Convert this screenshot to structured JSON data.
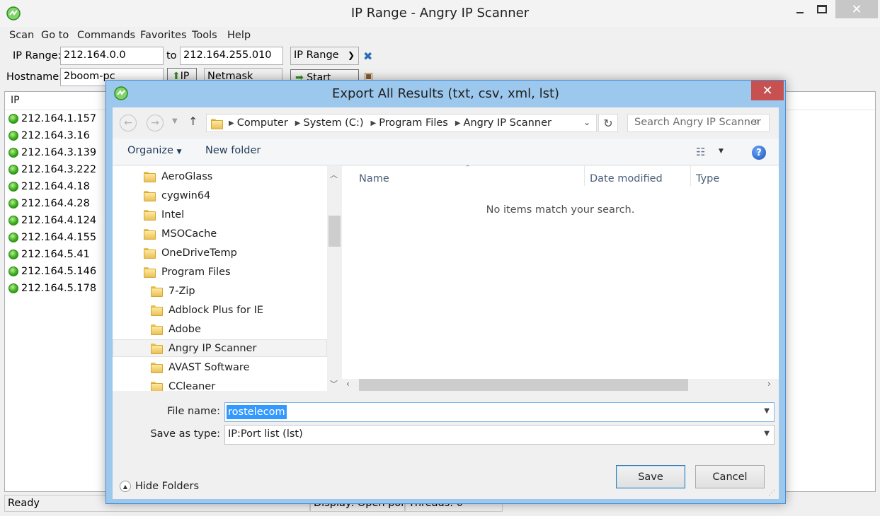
{
  "main_window": {
    "title": "IP Range - Angry IP Scanner",
    "menu": [
      "Scan",
      "Go to",
      "Commands",
      "Favorites",
      "Tools",
      "Help"
    ],
    "ip_range_label": "IP Range:",
    "ip_from": "212.164.0.0",
    "to_label": "to",
    "ip_to": "212.164.255.010",
    "feeder_select": "IP Range",
    "hostname_label": "Hostname:",
    "hostname": "2boom-pc",
    "ip_button": "IP",
    "netmask_select": "Netmask",
    "start_button": "Start",
    "column_ip": "IP",
    "results": [
      "212.164.1.157",
      "212.164.3.16",
      "212.164.3.139",
      "212.164.3.222",
      "212.164.4.18",
      "212.164.4.28",
      "212.164.4.124",
      "212.164.4.155",
      "212.164.5.41",
      "212.164.5.146",
      "212.164.5.178"
    ],
    "status_ready": "Ready",
    "status_display": "Display: Open ports",
    "status_threads": "Threads: 0"
  },
  "dialog": {
    "title": "Export All Results (txt, csv, xml, lst)",
    "breadcrumb": [
      "Computer",
      "System (C:)",
      "Program Files",
      "Angry IP Scanner"
    ],
    "search_placeholder": "Search Angry IP Scanner",
    "organize": "Organize",
    "new_folder": "New folder",
    "tree": [
      {
        "label": "AeroGlass",
        "level": 1
      },
      {
        "label": "cygwin64",
        "level": 1
      },
      {
        "label": "Intel",
        "level": 1
      },
      {
        "label": "MSOCache",
        "level": 1
      },
      {
        "label": "OneDriveTemp",
        "level": 1
      },
      {
        "label": "Program Files",
        "level": 1
      },
      {
        "label": "7-Zip",
        "level": 2
      },
      {
        "label": "Adblock Plus for IE",
        "level": 2
      },
      {
        "label": "Adobe",
        "level": 2
      },
      {
        "label": "Angry IP Scanner",
        "level": 2,
        "selected": true
      },
      {
        "label": "AVAST Software",
        "level": 2
      },
      {
        "label": "CCleaner",
        "level": 2
      }
    ],
    "columns": {
      "name": "Name",
      "date_modified": "Date modified",
      "type": "Type"
    },
    "empty_message": "No items match your search.",
    "file_name_label": "File name:",
    "file_name": "rostelecom",
    "save_as_type_label": "Save as type:",
    "save_as_type": "IP:Port list (lst)",
    "hide_folders": "Hide Folders",
    "save_button": "Save",
    "cancel_button": "Cancel"
  },
  "colors": {
    "dialog_frame": "#9cc8ee",
    "close_red": "#c75050",
    "selection_blue": "#3399ff",
    "status_green": "#3db01f"
  }
}
